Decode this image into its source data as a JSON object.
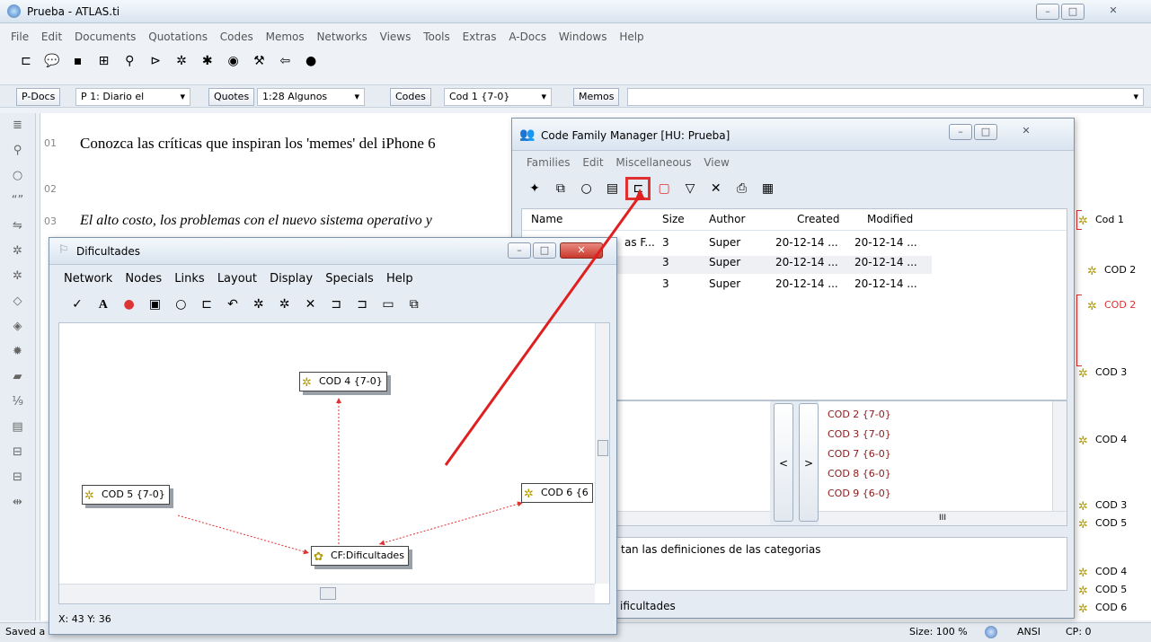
{
  "main": {
    "title": "Prueba - ATLAS.ti",
    "menu": [
      "File",
      "Edit",
      "Documents",
      "Quotations",
      "Codes",
      "Memos",
      "Networks",
      "Views",
      "Tools",
      "Extras",
      "A-Docs",
      "Windows",
      "Help"
    ],
    "bar": {
      "pdocs_label": "P-Docs",
      "pdocs_value": "P 1: Diario el",
      "quotes_label": "Quotes",
      "quotes_value": "1:28 Algunos",
      "codes_label": "Codes",
      "codes_value": "Cod 1 {7-0}",
      "memos_label": "Memos"
    },
    "doc_lines": [
      {
        "num": "01",
        "text": "Conozca las críticas que inspiran los 'memes' del iPhone 6"
      },
      {
        "num": "02",
        "text": ""
      },
      {
        "num": "03",
        "text": "El alto costo, los problemas con el nuevo sistema operativo y"
      }
    ],
    "margin_codes": [
      "Cod 1",
      "COD 2",
      "COD 2",
      "COD 3",
      "COD 4",
      "COD 3",
      "COD 5",
      "COD 4",
      "COD 5",
      "COD 6"
    ],
    "status": {
      "saved": "Saved a",
      "size": "Size: 100 %",
      "encoding": "ANSI",
      "cp": "CP: 0"
    }
  },
  "cfm": {
    "title": "Code Family Manager [HU: Prueba]",
    "menu": [
      "Families",
      "Edit",
      "Miscellaneous",
      "View"
    ],
    "columns": [
      "Name",
      "Size",
      "Author",
      "Created",
      "Modified"
    ],
    "rows": [
      {
        "name": "as F...",
        "size": "3",
        "author": "Super",
        "created": "20-12-14 ...",
        "modified": "20-12-14 ..."
      },
      {
        "name": "",
        "size": "3",
        "author": "Super",
        "created": "20-12-14 ...",
        "modified": "20-12-14 ..."
      },
      {
        "name": "",
        "size": "3",
        "author": "Super",
        "created": "20-12-14 ...",
        "modified": "20-12-14 ..."
      }
    ],
    "members": [
      "COD 2 {7-0}",
      "COD 3 {7-0}",
      "COD 7 {6-0}",
      "COD 8 {6-0}",
      "COD 9 {6-0}"
    ],
    "move_left": "<",
    "move_right": ">",
    "comment": "tan las definiciones de las categorias",
    "footer": "ificultades",
    "scroll_marker": "III"
  },
  "net": {
    "title": "Dificultades",
    "menu": [
      "Network",
      "Nodes",
      "Links",
      "Layout",
      "Display",
      "Specials",
      "Help"
    ],
    "nodes": {
      "cod4": "COD 4 {7-0}",
      "cod5": "COD 5 {7-0}",
      "cod6": "COD 6 {6",
      "cf": "CF:Dificultades"
    },
    "status": "X: 43 Y: 36"
  },
  "colors": {
    "member_text": "#8b1a1a",
    "highlight": "#e03030",
    "link": "#e03030"
  }
}
